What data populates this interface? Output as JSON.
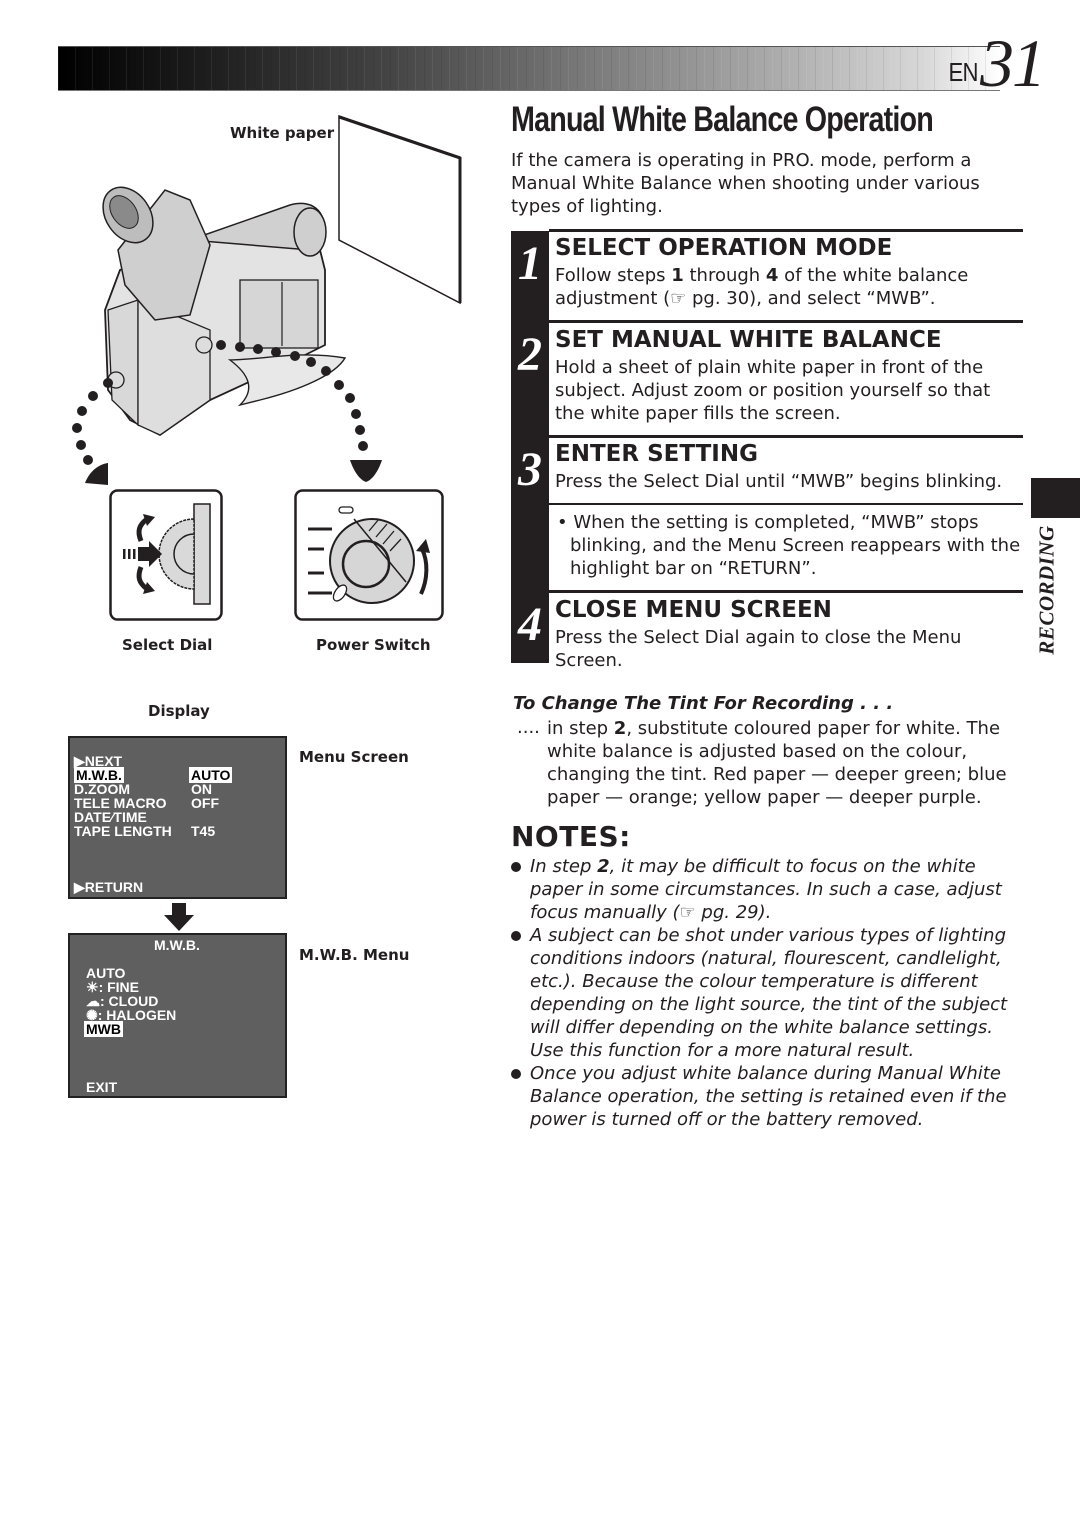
{
  "header": {
    "lang": "EN",
    "page_number": "31"
  },
  "title": "Manual White Balance Operation",
  "intro": "If the camera is operating in PRO. mode, perform a Manual White Balance when shooting under various types of lighting.",
  "steps": [
    {
      "number": "1",
      "heading": "SELECT OPERATION MODE",
      "body_parts": [
        "Follow steps ",
        "1",
        " through ",
        "4",
        " of the white balance adjustment (☞ pg. 30), and select “MWB”."
      ]
    },
    {
      "number": "2",
      "heading": "SET MANUAL WHITE BALANCE",
      "body": "Hold a sheet of plain white paper in front of the subject. Adjust zoom or position yourself so that the white paper fills the screen."
    },
    {
      "number": "3",
      "heading": "ENTER SETTING",
      "body": "Press the Select Dial until “MWB” begins blinking.",
      "bullet": "• When the setting is completed, “MWB” stops blinking, and the Menu Screen reappears with the highlight bar on “RETURN”."
    },
    {
      "number": "4",
      "heading": "CLOSE MENU SCREEN",
      "body": "Press the Select Dial again to close the Menu Screen."
    }
  ],
  "side_tab": "RECORDING",
  "tint": {
    "heading": "To Change The Tint For Recording . . .",
    "dots": "....",
    "body_parts": [
      "in step ",
      "2",
      ", substitute coloured paper for white. The white balance is adjusted based on the colour, changing the tint. Red paper — deeper green; blue paper — orange; yellow paper — deeper purple."
    ]
  },
  "notes": {
    "heading": "NOTES:",
    "items": [
      {
        "parts": [
          "In step ",
          "2",
          ", it may be difficult to focus on the white paper in some circumstances. In such a case, adjust focus manually (☞ pg. 29)."
        ]
      },
      {
        "text": "A subject can be shot under various types of lighting conditions indoors (natural, flourescent, candlelight, etc.). Because the colour temperature is different depending on the light source, the tint of the subject will differ depending on the white balance settings. Use this function for a more natural result."
      },
      {
        "text": "Once you adjust white balance during Manual White Balance operation, the setting is retained even if the power is turned off or the battery removed."
      }
    ]
  },
  "illustration": {
    "white_paper_label": "White paper",
    "select_dial_label": "Select Dial",
    "power_switch_label": "Power Switch"
  },
  "display": {
    "label": "Display",
    "menu_screen_label": "Menu Screen",
    "menu_screen": {
      "next": "▶NEXT",
      "rows": [
        {
          "name": "M.W.B.",
          "value": "AUTO",
          "highlighted": true
        },
        {
          "name": "D.ZOOM",
          "value": "ON"
        },
        {
          "name": "TELE MACRO",
          "value": "OFF"
        },
        {
          "name": "DATE⁄TIME",
          "value": ""
        },
        {
          "name": "TAPE LENGTH",
          "value": "T45"
        }
      ],
      "return": "▶RETURN"
    },
    "mwb_menu_label": "M.W.B. Menu",
    "mwb_menu": {
      "title": "M.W.B.",
      "items": [
        {
          "icon": "",
          "label": "AUTO"
        },
        {
          "icon": "sun-icon",
          "label": ": FINE"
        },
        {
          "icon": "cloud-icon",
          "label": ": CLOUD"
        },
        {
          "icon": "halogen-icon",
          "label": ": HALOGEN"
        },
        {
          "icon": "",
          "label": "MWB",
          "highlighted": true
        }
      ],
      "exit": "EXIT"
    }
  }
}
